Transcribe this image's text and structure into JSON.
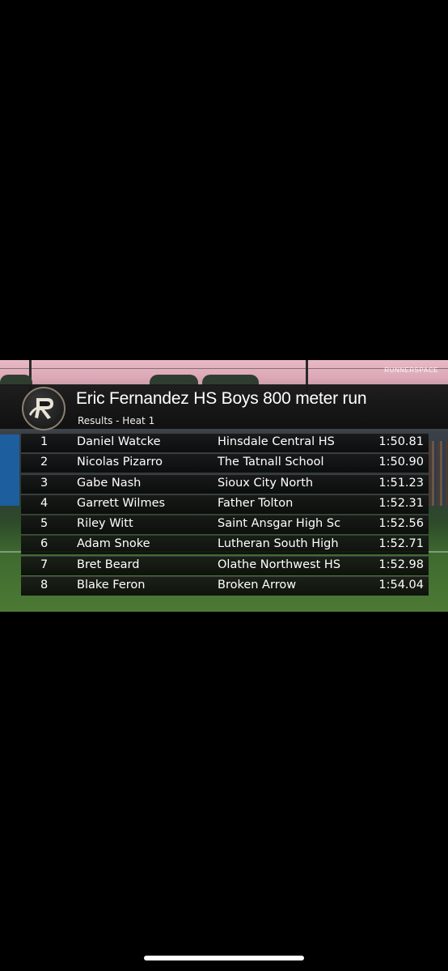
{
  "watermark": "RUNNERSPACE",
  "event": {
    "title": "Eric Fernandez HS Boys 800 meter run",
    "subtitle": "Results - Heat 1"
  },
  "results": [
    {
      "place": "1",
      "athlete": "Daniel Watcke",
      "school": "Hinsdale Central HS",
      "time": "1:50.81"
    },
    {
      "place": "2",
      "athlete": "Nicolas Pizarro",
      "school": "The Tatnall School",
      "time": "1:50.90"
    },
    {
      "place": "3",
      "athlete": "Gabe Nash",
      "school": "Sioux City North",
      "time": "1:51.23"
    },
    {
      "place": "4",
      "athlete": "Garrett Wilmes",
      "school": "Father Tolton",
      "time": "1:52.31"
    },
    {
      "place": "5",
      "athlete": "Riley Witt",
      "school": "Saint Ansgar High Sc",
      "time": "1:52.56"
    },
    {
      "place": "6",
      "athlete": "Adam Snoke",
      "school": "Lutheran South High",
      "time": "1:52.71"
    },
    {
      "place": "7",
      "athlete": "Bret Beard",
      "school": "Olathe Northwest HS",
      "time": "1:52.98"
    },
    {
      "place": "8",
      "athlete": "Blake Feron",
      "school": "Broken Arrow",
      "time": "1:54.04"
    }
  ]
}
